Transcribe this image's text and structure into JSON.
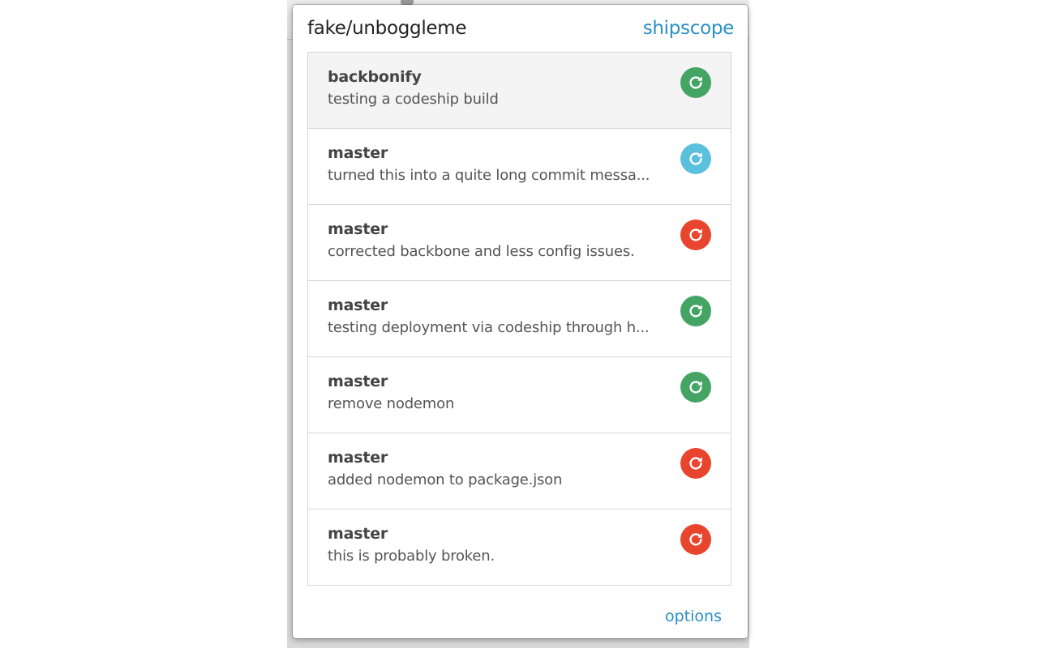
{
  "header": {
    "repo": "fake/unboggleme",
    "brand": "shipscope"
  },
  "status_colors": {
    "success": "#43a464",
    "testing": "#5bc0de",
    "error": "#e8452e"
  },
  "builds": [
    {
      "branch": "backbonify",
      "message": "testing a codeship build",
      "status": "success",
      "icon": "refresh-icon",
      "selected": true
    },
    {
      "branch": "master",
      "message": "turned this into a quite long commit messa...",
      "status": "testing",
      "icon": "refresh-icon",
      "selected": false
    },
    {
      "branch": "master",
      "message": "corrected backbone and less config issues.",
      "status": "error",
      "icon": "refresh-icon",
      "selected": false
    },
    {
      "branch": "master",
      "message": "testing deployment via codeship through h...",
      "status": "success",
      "icon": "refresh-icon",
      "selected": false
    },
    {
      "branch": "master",
      "message": "remove nodemon",
      "status": "success",
      "icon": "refresh-icon",
      "selected": false
    },
    {
      "branch": "master",
      "message": "added nodemon to package.json",
      "status": "error",
      "icon": "refresh-icon",
      "selected": false
    },
    {
      "branch": "master",
      "message": "this is probably broken.",
      "status": "error",
      "icon": "refresh-icon",
      "selected": false
    }
  ],
  "footer": {
    "options_label": "options"
  }
}
